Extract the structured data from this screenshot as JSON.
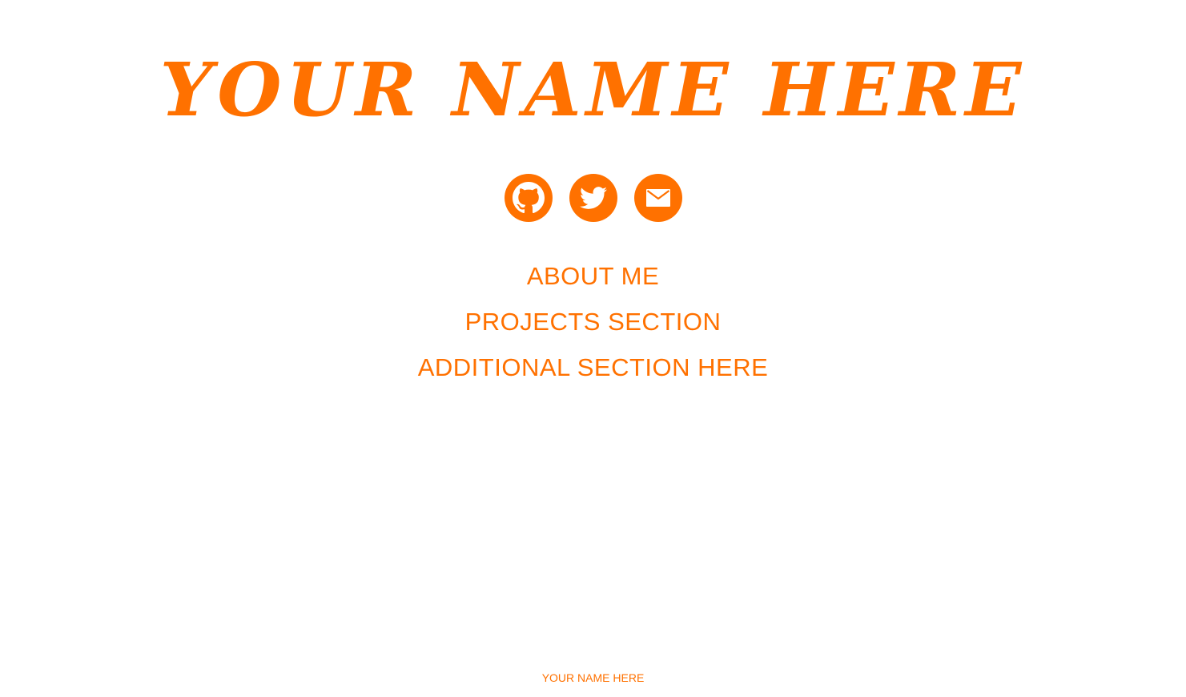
{
  "header": {
    "title": "YOUR NAME HERE"
  },
  "social": {
    "items": [
      {
        "name": "github",
        "icon": "github-icon"
      },
      {
        "name": "twitter",
        "icon": "twitter-icon"
      },
      {
        "name": "email",
        "icon": "mail-icon"
      }
    ]
  },
  "nav": {
    "items": [
      {
        "label": "ABOUT ME"
      },
      {
        "label": "PROJECTS SECTION"
      },
      {
        "label": "ADDITIONAL SECTION HERE"
      }
    ]
  },
  "footer": {
    "text": "YOUR NAME HERE"
  },
  "colors": {
    "accent": "#ff7100",
    "background": "#ffffff"
  }
}
